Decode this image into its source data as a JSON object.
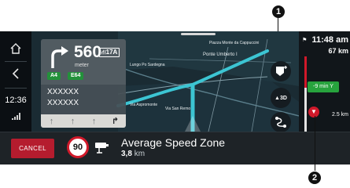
{
  "sidebar": {
    "home_icon": "home-icon",
    "back_icon": "chevron-left-icon",
    "clock": "12:36",
    "signal_icon": "signal-strength-icon"
  },
  "guidance": {
    "turn_icon": "turn-right-arrow-icon",
    "distance": "560",
    "distance_unit": "meter",
    "road_code": "17A",
    "road_badges": [
      "A4",
      "E64"
    ],
    "street_lines": [
      "XXXXXX",
      "XXXXXX"
    ],
    "lanes": [
      "↑",
      "↑",
      "↑",
      "↱"
    ]
  },
  "map": {
    "labels": [
      "Piazza Monte da Cappuccini",
      "Ponte Umberto I",
      "Lungo Po Sardegna",
      "Via Aspromonte",
      "Via San Remo"
    ]
  },
  "map_buttons": [
    "add-stop-icon",
    "3d-view-icon",
    "route-options-icon"
  ],
  "map_button_labels": {
    "view3d": "3D"
  },
  "route_bar": {
    "arrival_time": "11:48 am",
    "remaining_distance": "67 km",
    "eta_badge": "-9 min",
    "next_event_distance": "2.5 km",
    "colors": {
      "traffic": "#d0192a",
      "clear": "#27a33d"
    }
  },
  "alert": {
    "cancel_label": "CANCEL",
    "speed_limit": "90",
    "title": "Average Speed Zone",
    "distance_value": "3,8",
    "distance_unit": "km",
    "camera_icon": "speed-camera-icon"
  },
  "callouts": [
    "1",
    "2"
  ]
}
